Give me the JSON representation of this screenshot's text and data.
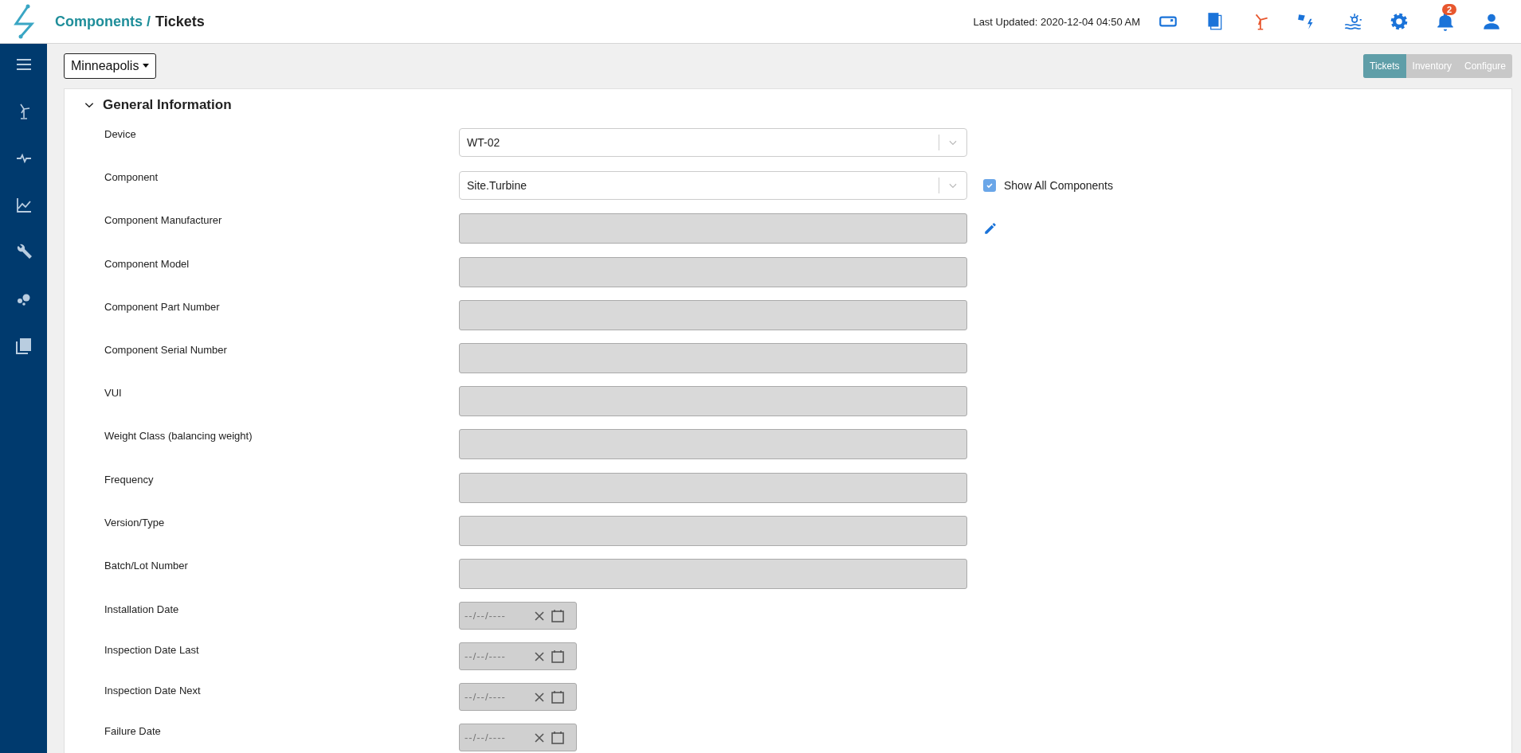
{
  "header": {
    "breadcrumb_parent": "Components /",
    "breadcrumb_current": "Tickets",
    "last_updated": "Last Updated: 2020-12-04 04:50 AM",
    "notification_count": "2"
  },
  "site_selector": {
    "value": "Minneapolis"
  },
  "view_tabs": [
    {
      "label": "Tickets",
      "selected": true
    },
    {
      "label": "Inventory",
      "selected": false
    },
    {
      "label": "Configure",
      "selected": false
    }
  ],
  "section": {
    "title": "General Information",
    "expanded": true
  },
  "fields": [
    {
      "label": "Device",
      "kind": "select",
      "value": "WT-02"
    },
    {
      "label": "Component",
      "kind": "select",
      "value": "Site.Turbine",
      "option": {
        "label": "Show All Components",
        "checked": true
      }
    },
    {
      "label": "Component Manufacturer",
      "kind": "text",
      "disabled": true,
      "editable": true
    },
    {
      "label": "Component Model",
      "kind": "text",
      "disabled": true
    },
    {
      "label": "Component Part Number",
      "kind": "text",
      "disabled": true
    },
    {
      "label": "Component Serial Number",
      "kind": "text",
      "disabled": true
    },
    {
      "label": "VUI",
      "kind": "text",
      "disabled": true
    },
    {
      "label": "Weight Class (balancing weight)",
      "kind": "text",
      "disabled": true
    },
    {
      "label": "Frequency",
      "kind": "text",
      "disabled": true
    },
    {
      "label": "Version/Type",
      "kind": "text",
      "disabled": true
    },
    {
      "label": "Batch/Lot Number",
      "kind": "text",
      "disabled": true
    },
    {
      "label": "Installation Date",
      "kind": "date",
      "placeholder": "--/--/----"
    },
    {
      "label": "Inspection Date Last",
      "kind": "date",
      "placeholder": "--/--/----"
    },
    {
      "label": "Inspection Date Next",
      "kind": "date",
      "placeholder": "--/--/----"
    },
    {
      "label": "Failure Date",
      "kind": "date",
      "placeholder": "--/--/----"
    }
  ]
}
